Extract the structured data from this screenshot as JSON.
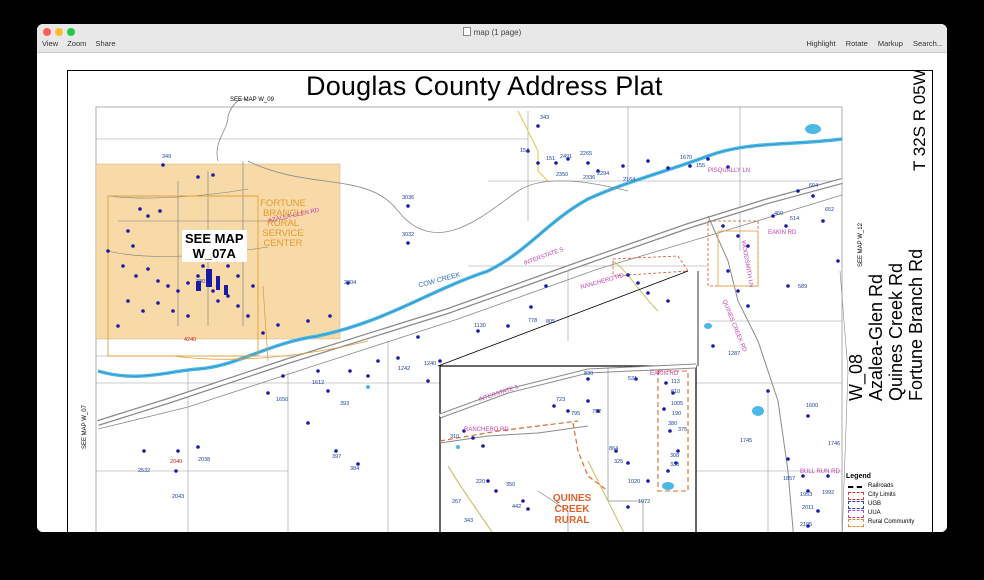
{
  "window": {
    "title": "map (1 page)",
    "menu_left": [
      "View",
      "Zoom",
      "Share"
    ],
    "menu_right": [
      "Highlight",
      "Rotate",
      "Markup",
      "Search..."
    ]
  },
  "map": {
    "title": "Douglas County Address Plat",
    "township": "T 32S R 05W",
    "map_id": "W_08",
    "roads_title": [
      "Azalea-Glen Rd",
      "Quines Creek Rd",
      "Fortune Branch Rd"
    ],
    "see_map_top": "SEE MAP W_09",
    "see_map_left": "SEE MAP W_07",
    "see_map_right": "SEE MAP W_12",
    "see_map_inset": [
      "SEE MAP",
      "W_07A"
    ],
    "fortune_label": [
      "FORTUNE",
      "BRANCH",
      "RURAL",
      "SERVICE",
      "CENTER"
    ],
    "quines_label": [
      "QUINES",
      "CREEK",
      "RURAL"
    ],
    "road_labels": {
      "azalea_glen": "AZALEA-GLEN RD",
      "interstate": "INTERSTATE 5",
      "ranchero": "RANCHERO RD",
      "eakin": "EAKIN RD",
      "pisqually": "PISQUALLY LN",
      "bull_run": "BULL RUN RD",
      "quines_creek": "QUINES CREEK RD",
      "woodsmith": "WOODSMITH LN",
      "inset_interstate": "INTERSTATE 5",
      "inset_ranchero": "RANCHERO RD",
      "inset_eakin": "EAKIN RD"
    },
    "creek": "COW CREEK",
    "addresses": {
      "a343": "343",
      "a154": "154",
      "a151": "151",
      "a2491": "2491",
      "a2265": "2265",
      "a2350": "2350",
      "a2336": "2336",
      "a2294": "2294",
      "a2164": "2164",
      "a1670": "1670",
      "a155": "155",
      "a349": "349",
      "a3036": "3036",
      "a3032": "3032",
      "a2804": "2804",
      "a1130": "1130",
      "a778": "778",
      "a805": "805",
      "a1612": "1612",
      "a1242": "1242",
      "a1240": "1240",
      "a1650": "1650",
      "a393": "393",
      "a397": "397",
      "a384": "384",
      "a2532": "2532",
      "a2040": "2040",
      "a2038": "2038",
      "a2043": "2043",
      "a4240": "4240",
      "a604": "604",
      "a652": "652",
      "a460": "460",
      "a514": "514",
      "a589": "589",
      "a1287": "1287",
      "a1600": "1600",
      "a1745": "1745",
      "a1746": "1746",
      "a1857": "1857",
      "a1953": "1953",
      "a1992": "1992",
      "a2011": "2011",
      "a2105": "2105",
      "a723": "723",
      "a795": "795",
      "a792": "792",
      "a310": "310",
      "a864": "864",
      "a325": "325",
      "a380": "380",
      "a375": "375",
      "a308": "308",
      "a330": "330",
      "a220": "220",
      "a350": "350",
      "a1020": "1020",
      "a1072": "1072",
      "a442": "442",
      "a267": "267",
      "a343b": "343",
      "a380b": "380",
      "a830": "830",
      "a531": "531",
      "a113": "113",
      "a610": "610",
      "a1005": "1005",
      "a190": "190"
    },
    "legend": {
      "title": "Legend",
      "items": [
        "Railroads",
        "City Limits",
        "UGB",
        "UUA",
        "Rural Community"
      ],
      "colors": [
        "#000000",
        "#d93c3c",
        "#2b3fa8",
        "#b24bc0",
        "#e6852b"
      ]
    },
    "colors": {
      "rural_center_fill": "#f8d9a8",
      "rural_center_border": "#e0a23a",
      "creek": "#4cb8e6",
      "road_label": "#c23fb3",
      "address_dot": "#1a1aa8",
      "address_text": "#1a3fa8"
    }
  }
}
